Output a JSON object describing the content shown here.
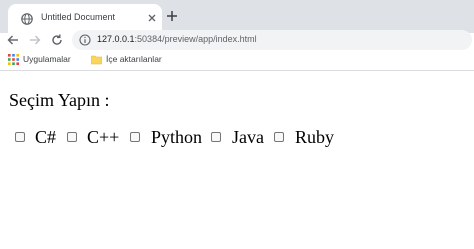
{
  "browser": {
    "tab": {
      "title": "Untitled Document"
    },
    "address": {
      "host": "127.0.0.1",
      "rest": ":50384/preview/app/index.html"
    },
    "bookmarks": [
      {
        "label": "Uygulamalar",
        "icon": "apps-grid-icon"
      },
      {
        "label": "İçe aktarılanlar",
        "icon": "folder-icon"
      }
    ]
  },
  "page": {
    "prompt": "Seçim Yapın :",
    "options": [
      {
        "label": "C#",
        "checked": false
      },
      {
        "label": "C++",
        "checked": false
      },
      {
        "label": "Python",
        "checked": false
      },
      {
        "label": "Java",
        "checked": false
      },
      {
        "label": "Ruby",
        "checked": false
      }
    ]
  },
  "colors": {
    "tabstrip_bg": "#dee1e6",
    "omnibox_bg": "#f1f3f4",
    "text_dark": "#202124",
    "text_muted": "#5f6368"
  }
}
